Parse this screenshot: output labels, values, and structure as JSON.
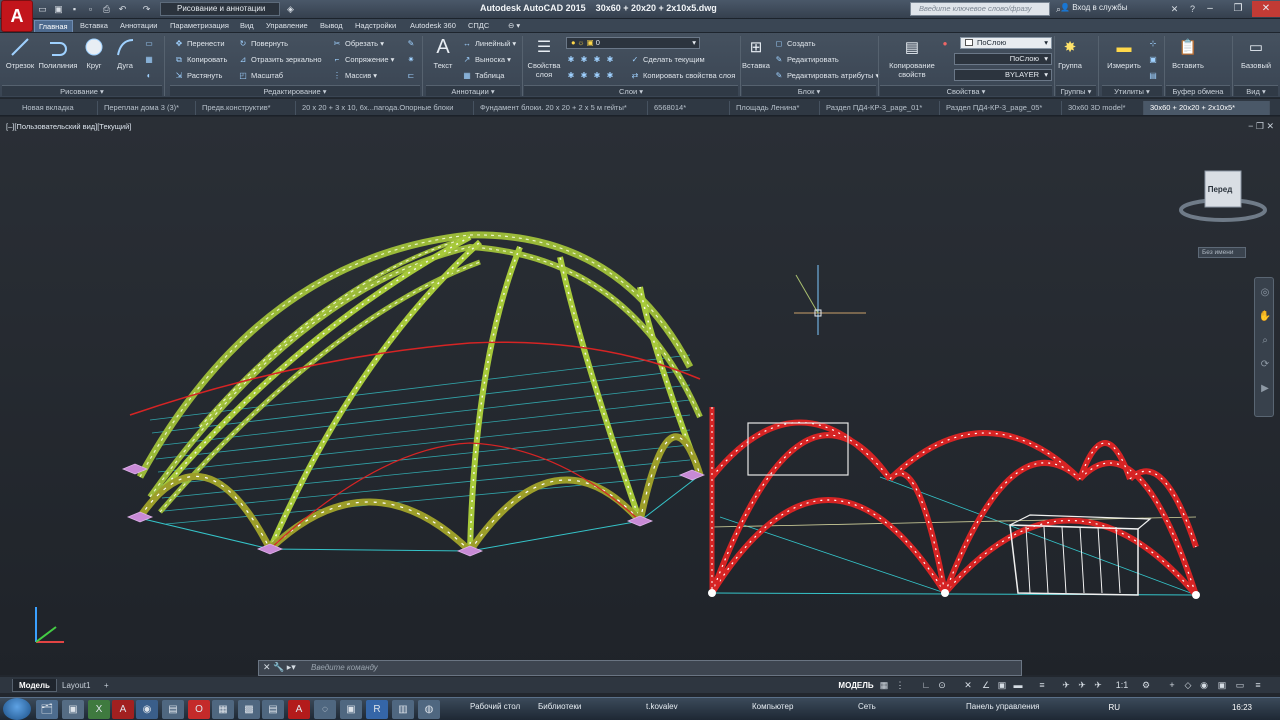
{
  "app": {
    "logo": "A",
    "title": "Autodesk AutoCAD 2015    30x60 + 20x20 + 2x10x5.dwg"
  },
  "quick_access": {
    "workspace": "Рисование и аннотации"
  },
  "search": {
    "placeholder": "Введите ключевое слово/фразу"
  },
  "signin": "Вход в службы",
  "ribbon_tabs": [
    "Главная",
    "Вставка",
    "Аннотации",
    "Параметризация",
    "Вид",
    "Управление",
    "Вывод",
    "Надстройки",
    "Autodesk 360",
    "СПДС"
  ],
  "panels": {
    "draw": {
      "title": "Рисование",
      "line": "Отрезок",
      "polyline": "Полилиния",
      "circle": "Круг",
      "arc": "Дуга"
    },
    "modify": {
      "title": "Редактирование",
      "move": "Перенести",
      "copy": "Копировать",
      "stretch": "Растянуть",
      "rotate": "Повернуть",
      "mirror": "Отразить зеркально",
      "scale": "Масштаб",
      "trim": "Обрезать",
      "fillet": "Сопряжение",
      "array": "Массив"
    },
    "annotation": {
      "title": "Аннотации",
      "text": "Текст",
      "linear": "Линейный",
      "leader": "Выноска",
      "table": "Таблица"
    },
    "layers": {
      "title": "Слои",
      "props": "Свойства слоя",
      "layer_value": "0",
      "make_current": "Сделать текущим",
      "match_layer": "Копировать свойства слоя"
    },
    "block": {
      "title": "Блок",
      "insert": "Вставка",
      "create": "Создать",
      "edit": "Редактировать",
      "edit_attr": "Редактировать атрибуты"
    },
    "properties": {
      "title": "Свойства",
      "match": "Копирование свойств",
      "color": "ПоСлою",
      "linetype": "ПоСлою",
      "lineweight": "BYLAYER"
    },
    "groups": {
      "title": "Группы",
      "group": "Группа"
    },
    "utilities": {
      "title": "Утилиты",
      "measure": "Измерить"
    },
    "clipboard": {
      "title": "Буфер обмена",
      "paste": "Вставить"
    },
    "view": {
      "title": "Вид",
      "base": "Базовый"
    }
  },
  "file_tabs": [
    "Новая вкладка",
    "Переплан дома 3 (3)*",
    "Предв.конструктив*",
    "20 х 20 + 3 х 10, 6х...пагода.Опорные блоки",
    "Фундамент блоки. 20 х 20 + 2 х 5 м гейты*",
    "6568014*",
    "Площадь Ленина*",
    "Раздел ПД4-КР-3_page_01*",
    "Раздел ПД4-КР-3_page_05*",
    "30x60 3D model*",
    "30x60 + 20x20 + 2x10x5*"
  ],
  "viewport": {
    "label": "[–][Пользовательский вид][Текущий]",
    "viewcube_face": "Перед",
    "ucs_name": "Без имени"
  },
  "command": {
    "prompt": "Введите команду"
  },
  "layout_tabs": [
    "Модель",
    "Layout1",
    "+"
  ],
  "status": {
    "model": "МОДЕЛЬ",
    "scale": "1:1"
  },
  "taskbar": {
    "items": [
      "Рабочий стол",
      "Библиотеки",
      "t.kovalev",
      "Компьютер",
      "Сеть",
      "Панель управления"
    ],
    "lang": "RU",
    "clock": "16:23"
  },
  "colors": {
    "accent": "#c2151b",
    "tent_large": "#a7c93a",
    "tent_small": "#d62424",
    "guide_lines": "#35c4c9"
  }
}
